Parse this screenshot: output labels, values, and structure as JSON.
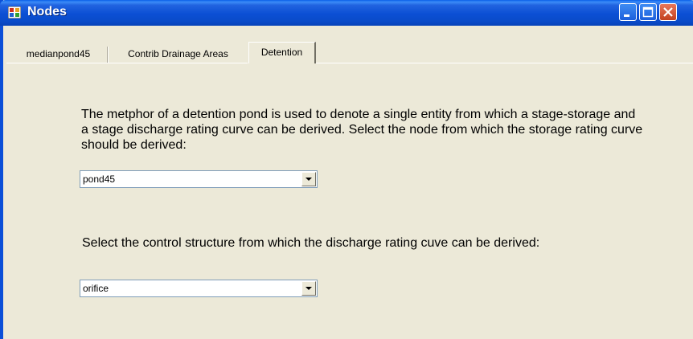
{
  "window": {
    "title": "Nodes"
  },
  "tabs": [
    {
      "label": "medianpond45"
    },
    {
      "label": "Contrib Drainage Areas"
    },
    {
      "label": "Detention",
      "selected": true
    }
  ],
  "detention": {
    "description": "The metphor of a detention pond is used to denote a single entity from which a stage-storage and a stage discharge rating curve can be derived.  Select the node from which the storage rating curve should be derived:",
    "node_select": {
      "value": "pond45"
    },
    "control_prompt": "Select the control structure from which the discharge rating cuve can be derived:",
    "control_select": {
      "value": "orifice"
    }
  },
  "colors": {
    "titlebar": "#0b4fd4",
    "panel": "#ece9d8",
    "close": "#c2411f"
  }
}
